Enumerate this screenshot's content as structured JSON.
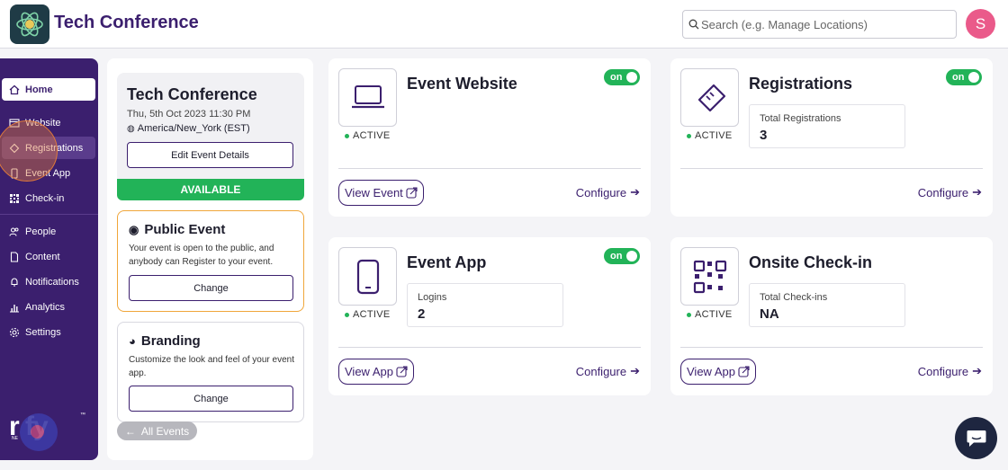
{
  "header": {
    "title": "Tech Conference",
    "search_placeholder": "Search (e.g. Manage Locations)",
    "avatar_initial": "S"
  },
  "sidebar": {
    "items": [
      {
        "label": "Home",
        "icon": "home-icon"
      },
      {
        "label": "Website",
        "icon": "website-icon"
      },
      {
        "label": "Registrations",
        "icon": "ticket-icon"
      },
      {
        "label": "Event App",
        "icon": "phone-icon"
      },
      {
        "label": "Check-in",
        "icon": "qr-icon"
      },
      {
        "label": "People",
        "icon": "people-icon"
      },
      {
        "label": "Content",
        "icon": "document-icon"
      },
      {
        "label": "Notifications",
        "icon": "bell-icon"
      },
      {
        "label": "Analytics",
        "icon": "chart-icon"
      },
      {
        "label": "Settings",
        "icon": "gear-icon"
      }
    ],
    "brand": "r   fy",
    "brand_tm": "™",
    "brand_sub": "NE"
  },
  "event": {
    "title": "Tech Conference",
    "date": "Thu, 5th Oct 2023 11:30 PM",
    "timezone": "America/New_York (EST)",
    "edit_label": "Edit Event Details",
    "status": "AVAILABLE"
  },
  "public_event": {
    "title": "Public Event",
    "description": "Your event is open to the public, and anybody can Register to your event.",
    "button": "Change"
  },
  "branding": {
    "title": "Branding",
    "description": "Customize the look and feel of your event app.",
    "button": "Change"
  },
  "all_events_label": "All Events",
  "cards": {
    "website": {
      "title": "Event Website",
      "toggle": "on",
      "status": "ACTIVE",
      "view": "View Event",
      "configure": "Configure"
    },
    "registrations": {
      "title": "Registrations",
      "toggle": "on",
      "status": "ACTIVE",
      "stat_label": "Total Registrations",
      "stat_value": "3",
      "configure": "Configure"
    },
    "app": {
      "title": "Event App",
      "toggle": "on",
      "status": "ACTIVE",
      "stat_label": "Logins",
      "stat_value": "2",
      "view": "View App",
      "configure": "Configure"
    },
    "checkin": {
      "title": "Onsite Check-in",
      "status": "ACTIVE",
      "stat_label": "Total Check-ins",
      "stat_value": "NA",
      "view": "View App",
      "configure": "Configure"
    }
  },
  "colors": {
    "brand_purple": "#3b1f6e",
    "active_green": "#22b358",
    "public_border": "#f0a63a",
    "avatar": "#ea5a8a"
  }
}
